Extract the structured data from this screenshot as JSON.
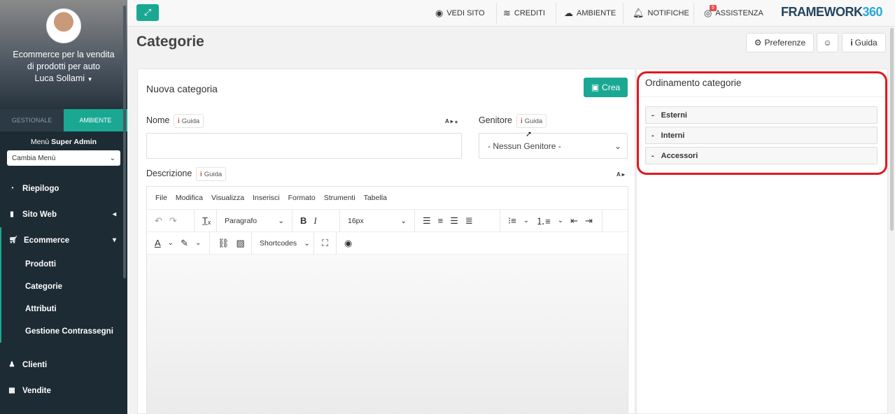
{
  "sidebar": {
    "org": "Ecommerce per la vendita di prodotti per auto",
    "user": "Luca Sollami",
    "tabs": [
      "GESTIONALE",
      "AMBIENTE"
    ],
    "menu_label_prefix": "Menù",
    "menu_label_strong": "Super Admin",
    "menu_select": "Cambia Menù",
    "items": [
      {
        "label": "Riepilogo",
        "icon": "dashboard-icon"
      },
      {
        "label": "Sito Web",
        "icon": "file-icon"
      },
      {
        "label": "Ecommerce",
        "icon": "cart-icon"
      }
    ],
    "sub_items": [
      "Prodotti",
      "Categorie",
      "Attributi",
      "Gestione Contrassegni"
    ],
    "bottom_items": [
      {
        "label": "Clienti",
        "icon": "user-icon"
      },
      {
        "label": "Vendite",
        "icon": "calculator-icon"
      }
    ]
  },
  "topbar": {
    "links": [
      "VEDI SITO",
      "CREDITI",
      "AMBIENTE",
      "NOTIFICHE",
      "ASSISTENZA"
    ],
    "badge": "5",
    "logo_a": "FRAMEWORK",
    "logo_b": "360"
  },
  "header": {
    "title": "Categorie",
    "buttons": [
      "Preferenze",
      "☺",
      "Guida"
    ]
  },
  "form": {
    "title": "Nuova categoria",
    "create": "Crea",
    "name_label": "Nome",
    "parent_label": "Genitore",
    "guide": "Guida",
    "parent_value": "- Nessun Genitore -",
    "desc_label": "Descrizione",
    "translate": "A",
    "editor": {
      "menu": [
        "File",
        "Modifica",
        "Visualizza",
        "Inserisci",
        "Formato",
        "Strumenti",
        "Tabella"
      ],
      "block": "Paragrafo",
      "size": "16px",
      "shortcodes": "Shortcodes"
    }
  },
  "ordering": {
    "title": "Ordinamento categorie",
    "items": [
      "Esterni",
      "Interni",
      "Accessori"
    ]
  },
  "colors": {
    "accent": "#1aa893",
    "sidebar": "#1d2b34",
    "highlight": "#e0191f"
  }
}
